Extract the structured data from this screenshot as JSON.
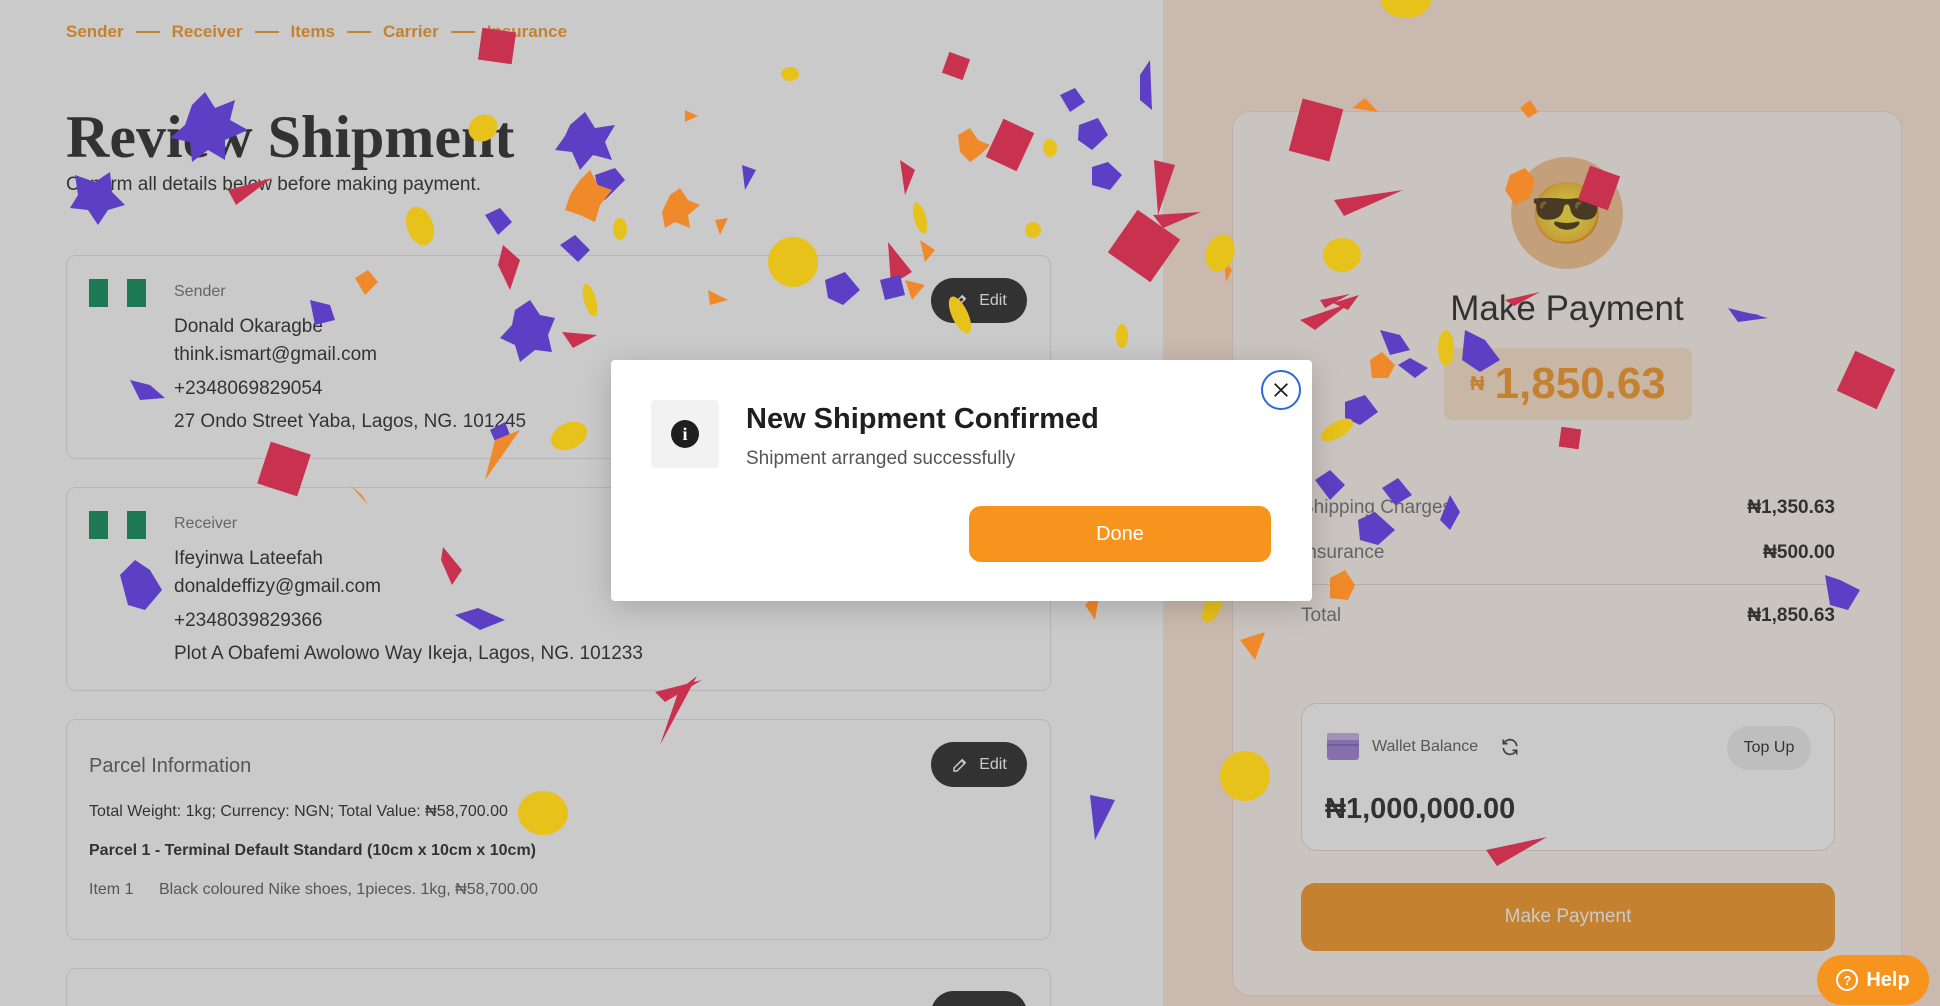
{
  "steps": [
    "Sender",
    "Receiver",
    "Items",
    "Carrier",
    "Insurance"
  ],
  "page": {
    "title": "Review Shipment",
    "subtitle": "Confirm all details below before making payment."
  },
  "sender": {
    "label": "Sender",
    "name": "Donald Okaragbe",
    "email": "think.ismart@gmail.com",
    "phone": "+2348069829054",
    "address": "27 Ondo Street Yaba, Lagos, NG. 101245",
    "edit_label": "Edit"
  },
  "receiver": {
    "label": "Receiver",
    "name": "Ifeyinwa Lateefah",
    "email": "donaldeffizy@gmail.com",
    "phone": "+2348039829366",
    "address": "Plot A Obafemi Awolowo Way Ikeja, Lagos, NG. 101233"
  },
  "parcel": {
    "title": "Parcel Information",
    "edit_label": "Edit",
    "summary": "Total Weight: 1kg; Currency: NGN; Total Value: ₦58,700.00",
    "name": "Parcel 1 - Terminal Default Standard (10cm x 10cm x 10cm)",
    "item_label": "Item 1",
    "item_desc": "Black coloured Nike shoes, 1pieces. 1kg, ₦58,700.00"
  },
  "payment": {
    "emoji": "😎",
    "title": "Make Payment",
    "currency_symbol": "₦",
    "amount": "1,850.63",
    "rows": [
      {
        "label": "Shipping Charges",
        "value": "₦1,350.63"
      },
      {
        "label": "Insurance",
        "value": "₦500.00"
      }
    ],
    "total_label": "Total",
    "total_value": "₦1,850.63",
    "wallet": {
      "label": "Wallet Balance",
      "balance": "₦1,000,000.00",
      "topup_label": "Top Up"
    },
    "make_payment_label": "Make Payment"
  },
  "help_label": "Help",
  "modal": {
    "icon": "info-icon",
    "title": "New Shipment Confirmed",
    "subtitle": "Shipment arranged successfully",
    "done_label": "Done"
  },
  "colors": {
    "accent": "#f7941d",
    "dark": "#1f1f1f",
    "flag_green": "#008751",
    "close_ring": "#2d6bd6",
    "confetti": [
      "#c8324f",
      "#5c3fc4",
      "#f0892a",
      "#e7c21b"
    ]
  }
}
